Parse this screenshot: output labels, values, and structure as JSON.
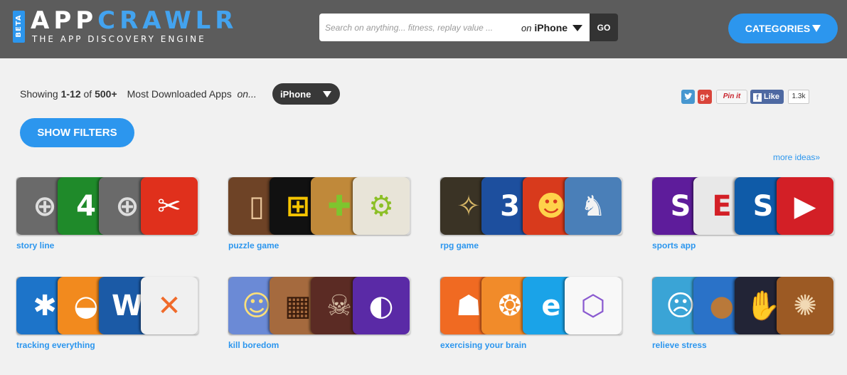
{
  "header": {
    "beta": "BETA",
    "logo_part1": "APP",
    "logo_part2": "CRAWLR",
    "tagline": "THE APP DISCOVERY ENGINE",
    "search_placeholder": "Search on anything... fitness, replay value ...",
    "platform_prefix": "on",
    "platform": "iPhone",
    "go_label": "GO",
    "categories_label": "CATEGORIES"
  },
  "results": {
    "showing": "Showing",
    "range": "1-12",
    "of": "of",
    "total": "500+",
    "sort": "Most Downloaded Apps",
    "on": "on...",
    "device": "iPhone"
  },
  "social": {
    "gplus": "g+",
    "pinit": "Pin it",
    "fb_like": "Like",
    "fb_count": "1.3k"
  },
  "filters_label": "SHOW FILTERS",
  "more_ideas": "more ideas»",
  "ideas": [
    {
      "label": "story line",
      "icons": [
        {
          "name": "sniper-scope-icon",
          "bg": "#6a6a6a",
          "fg": "#ddd",
          "glyph": "⊕"
        },
        {
          "name": "zenonia-4-icon",
          "bg": "#1f8a2a",
          "fg": "#fff",
          "glyph": "4"
        },
        {
          "name": "sniper-scope-icon",
          "bg": "#6a6a6a",
          "fg": "#ddd",
          "glyph": "⊕"
        },
        {
          "name": "infinity-blade-icon",
          "bg": "#e0301c",
          "fg": "#fff",
          "glyph": "✂"
        }
      ]
    },
    {
      "label": "puzzle game",
      "icons": [
        {
          "name": "door-icon",
          "bg": "#6e4326",
          "fg": "#e8c49a",
          "glyph": "▯"
        },
        {
          "name": "flow-pipes-icon",
          "bg": "#111111",
          "fg": "#f5c400",
          "glyph": "⊞"
        },
        {
          "name": "jigsaw-icon",
          "bg": "#c0893a",
          "fg": "#7ec52e",
          "glyph": "✚"
        },
        {
          "name": "gears-icon",
          "bg": "#e8e4d8",
          "fg": "#8cbf26",
          "glyph": "⚙"
        }
      ]
    },
    {
      "label": "rpg game",
      "icons": [
        {
          "name": "dragon-emblem-icon",
          "bg": "#3a3325",
          "fg": "#d9b968",
          "glyph": "✧"
        },
        {
          "name": "zenonia-3-icon",
          "bg": "#1d4f9e",
          "fg": "#fff",
          "glyph": "3"
        },
        {
          "name": "hero-warrior-icon",
          "bg": "#d83a1c",
          "fg": "#ffd24a",
          "glyph": "☻"
        },
        {
          "name": "knight-icon",
          "bg": "#4a7fb8",
          "fg": "#f3f3f3",
          "glyph": "♞"
        }
      ]
    },
    {
      "label": "sports app",
      "icons": [
        {
          "name": "yahoo-sports-icon",
          "bg": "#5e1c9b",
          "fg": "#fff",
          "glyph": "S"
        },
        {
          "name": "espn-icon",
          "bg": "#e8e8e8",
          "fg": "#d31f26",
          "glyph": "E"
        },
        {
          "name": "sports-illustrated-icon",
          "bg": "#0f5ba8",
          "fg": "#fff",
          "glyph": "S"
        },
        {
          "name": "watch-espn-icon",
          "bg": "#d31f26",
          "fg": "#fff",
          "glyph": "▶"
        }
      ]
    },
    {
      "label": "tracking everything",
      "icons": [
        {
          "name": "fitness-pal-icon",
          "bg": "#1d74c9",
          "fg": "#fff",
          "glyph": "✱"
        },
        {
          "name": "scale-icon",
          "bg": "#f28a1e",
          "fg": "#fff",
          "glyph": "◒"
        },
        {
          "name": "weight-watchers-icon",
          "bg": "#1b5aa6",
          "fg": "#fff",
          "glyph": "W"
        },
        {
          "name": "fork-knife-icon",
          "bg": "#f0f0f0",
          "fg": "#f06a2a",
          "glyph": "✕"
        }
      ]
    },
    {
      "label": "kill boredom",
      "icons": [
        {
          "name": "anime-girl-icon",
          "bg": "#6b8ad6",
          "fg": "#fbe07a",
          "glyph": "☺"
        },
        {
          "name": "checkers-icon",
          "bg": "#a56a3e",
          "fg": "#3b1c0c",
          "glyph": "▦"
        },
        {
          "name": "zombie-icon",
          "bg": "#5b2b24",
          "fg": "#d8c1a8",
          "glyph": "☠"
        },
        {
          "name": "purple-circle-icon",
          "bg": "#5a2aa6",
          "fg": "#fff",
          "glyph": "◐"
        }
      ]
    },
    {
      "label": "exercising your brain",
      "icons": [
        {
          "name": "head-profile-icon",
          "bg": "#f06a22",
          "fg": "#fff",
          "glyph": "☗"
        },
        {
          "name": "brain-icon",
          "bg": "#f18b2a",
          "fg": "#fff",
          "glyph": "❂"
        },
        {
          "name": "elevate-icon",
          "bg": "#1aa3e8",
          "fg": "#fff",
          "glyph": "e"
        },
        {
          "name": "hexagon-icon",
          "bg": "#f8f8f8",
          "fg": "#8a5ad0",
          "glyph": "⬡"
        }
      ]
    },
    {
      "label": "relieve stress",
      "icons": [
        {
          "name": "angry-chef-icon",
          "bg": "#3aa4d6",
          "fg": "#fff",
          "glyph": "☹"
        },
        {
          "name": "cookie-icon",
          "bg": "#2a72c8",
          "fg": "#b9793a",
          "glyph": "●"
        },
        {
          "name": "fingerzilla-icon",
          "bg": "#222436",
          "fg": "#c9cde0",
          "glyph": "✋"
        },
        {
          "name": "mandala-icon",
          "bg": "#9c5a24",
          "fg": "#f1d9b4",
          "glyph": "✺"
        }
      ]
    }
  ]
}
